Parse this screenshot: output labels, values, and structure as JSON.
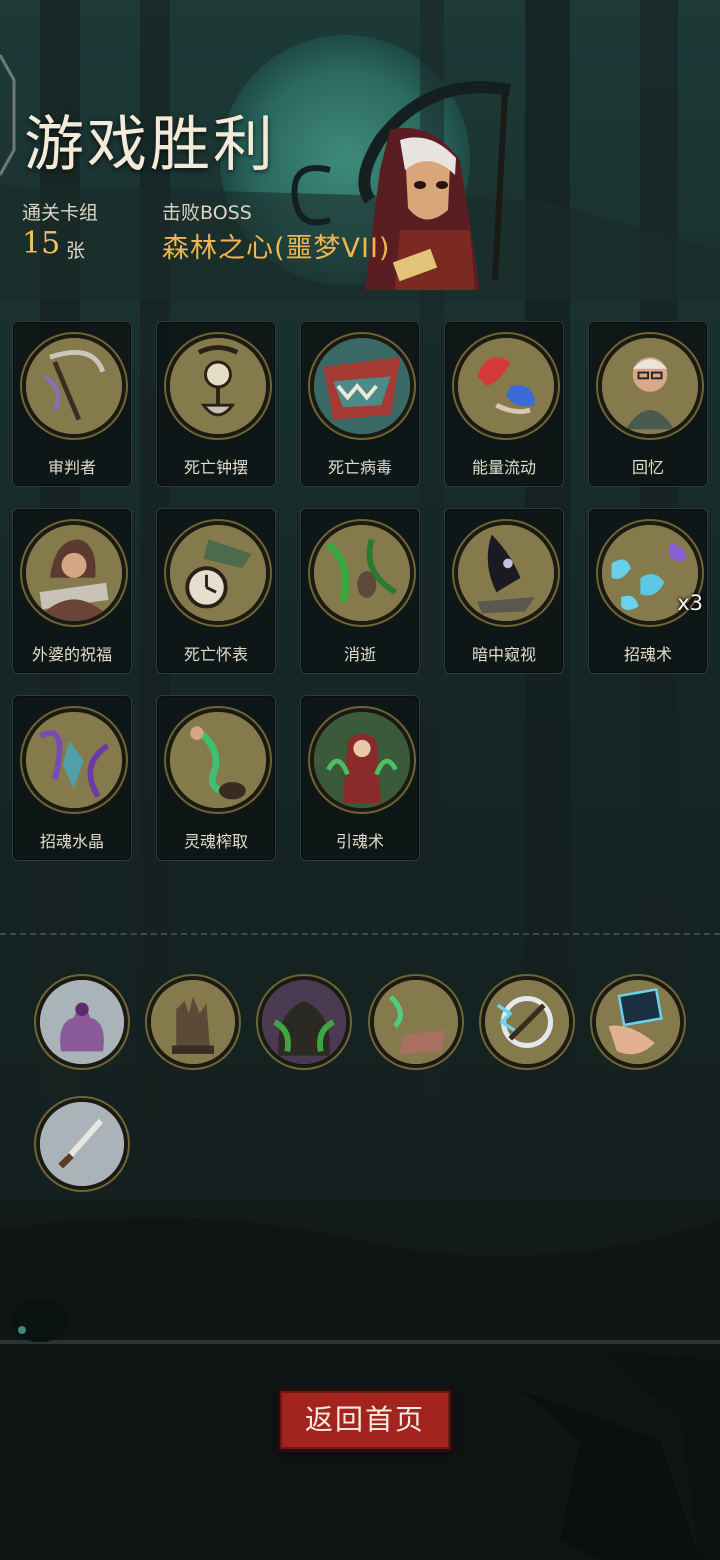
{
  "header": {
    "title": "游戏胜利",
    "deck_label": "通关卡组",
    "deck_count": "15",
    "deck_unit": "张",
    "boss_label": "击败BOSS",
    "boss_name": "森林之心(噩梦VII)"
  },
  "cards": [
    {
      "name": "审判者",
      "icon": "scythe-icon",
      "art_color": "#857a4b",
      "badge": ""
    },
    {
      "name": "死亡钟摆",
      "icon": "pendulum-icon",
      "art_color": "#857a4b",
      "badge": ""
    },
    {
      "name": "死亡病毒",
      "icon": "virus-beast-icon",
      "art_color": "#3b6a66",
      "badge": ""
    },
    {
      "name": "能量流动",
      "icon": "energy-flow-icon",
      "art_color": "#857a4b",
      "badge": ""
    },
    {
      "name": "回忆",
      "icon": "old-man-icon",
      "art_color": "#857a4b",
      "badge": ""
    },
    {
      "name": "外婆的祝福",
      "icon": "grandmother-icon",
      "art_color": "#857a4b",
      "badge": ""
    },
    {
      "name": "死亡怀表",
      "icon": "pocket-watch-icon",
      "art_color": "#857a4b",
      "badge": ""
    },
    {
      "name": "消逝",
      "icon": "fading-icon",
      "art_color": "#857a4b",
      "badge": ""
    },
    {
      "name": "暗中窥视",
      "icon": "shadow-peek-icon",
      "art_color": "#857a4b",
      "badge": ""
    },
    {
      "name": "招魂术",
      "icon": "soul-summon-icon",
      "art_color": "#857a4b",
      "badge": "x3"
    },
    {
      "name": "招魂水晶",
      "icon": "soul-crystal-icon",
      "art_color": "#857a4b",
      "badge": ""
    },
    {
      "name": "灵魂榨取",
      "icon": "soul-extract-icon",
      "art_color": "#857a4b",
      "badge": ""
    },
    {
      "name": "引魂术",
      "icon": "soul-guide-icon",
      "art_color": "#857a4b",
      "badge": ""
    }
  ],
  "relics": [
    {
      "icon": "tentacle-monster-relic-icon",
      "color": "#a9b3b8"
    },
    {
      "icon": "stone-hand-relic-icon",
      "color": "#857a4b"
    },
    {
      "icon": "ghost-relic-icon",
      "color": "#6e6a8e"
    },
    {
      "icon": "spirit-bed-relic-icon",
      "color": "#857a4b"
    },
    {
      "icon": "lightning-compass-relic-icon",
      "color": "#857a4b"
    },
    {
      "icon": "hand-card-relic-icon",
      "color": "#857a4b"
    },
    {
      "icon": "dagger-relic-icon",
      "color": "#a9b3b8"
    }
  ],
  "footer": {
    "back_label": "返回首页"
  },
  "colors": {
    "accent_gold": "#f0b650",
    "button_red": "#a3231f",
    "card_frame": "#6f6436"
  }
}
